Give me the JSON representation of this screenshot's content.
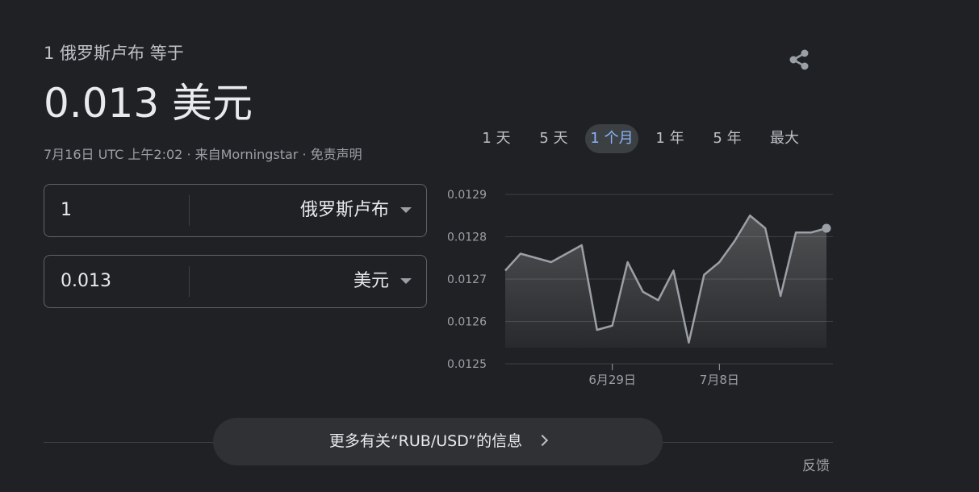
{
  "header": {
    "subtitle": "1 俄罗斯卢布 等于",
    "value": "0.013 美元",
    "meta": "7月16日 UTC 上午2:02 · 来自Morningstar · 免责声明"
  },
  "converter": {
    "from": {
      "value": "1",
      "currency": "俄罗斯卢布"
    },
    "to": {
      "value": "0.013",
      "currency": "美元"
    }
  },
  "tabs": [
    {
      "label": "1 天"
    },
    {
      "label": "5 天"
    },
    {
      "label": "1 个月",
      "active": true
    },
    {
      "label": "1 年"
    },
    {
      "label": "5 年"
    },
    {
      "label": "最大"
    }
  ],
  "chart_data": {
    "type": "area",
    "ylim": [
      0.0125,
      0.0129
    ],
    "yticks": [
      "0.0129",
      "0.0128",
      "0.0127",
      "0.0126",
      "0.0125"
    ],
    "xtick_labels": [
      "6月29日",
      "7月8日"
    ],
    "xtick_indices": [
      7,
      14
    ],
    "values": [
      0.01272,
      0.01276,
      0.01275,
      0.01274,
      0.01276,
      0.01278,
      0.01258,
      0.01259,
      0.01274,
      0.01267,
      0.01265,
      0.01272,
      0.01255,
      0.01271,
      0.01274,
      0.01279,
      0.01285,
      0.01282,
      0.01266,
      0.01281,
      0.01281,
      0.01282
    ],
    "line_color": "#9aa0a6",
    "grid": true
  },
  "more_info": {
    "label": "更多有关“RUB/USD”的信息"
  },
  "feedback": "反馈",
  "colors": {
    "background": "#202124",
    "accent": "#8ab4f8"
  },
  "icons": {
    "share": "share-icon",
    "caret": "caret-down-icon",
    "chevron": "chevron-right-icon"
  }
}
